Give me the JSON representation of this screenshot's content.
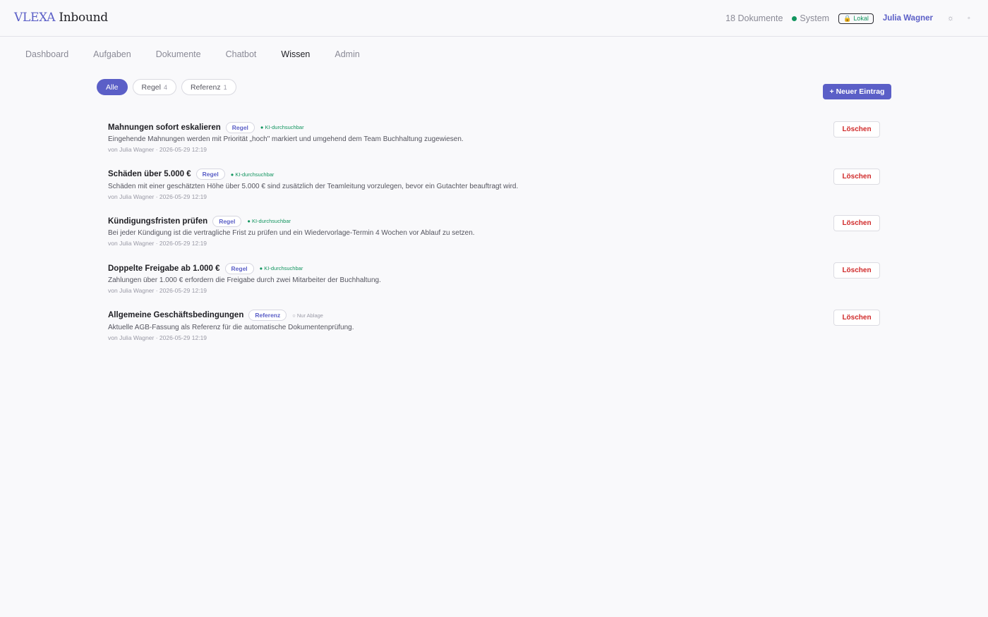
{
  "header": {
    "brand": "VLEXA",
    "product": "Inbound",
    "doc_count": "18 Dokumente",
    "system_status": "System",
    "local_badge": "Lokal",
    "user_name": "Julia Wagner",
    "icons": [
      "sun-icon",
      "settings-dot-icon"
    ],
    "status_color": "#12955f"
  },
  "nav": {
    "tabs": [
      "Dashboard",
      "Aufgaben",
      "Dokumente",
      "Chatbot",
      "Wissen",
      "Admin"
    ],
    "active": "Wissen"
  },
  "filters": {
    "all": "Alle",
    "rule": "Regel",
    "rule_count": "4",
    "reference": "Referenz",
    "reference_count": "1",
    "active": "Alle"
  },
  "new_entry_button": "+ Neuer Eintrag",
  "entries": [
    {
      "title": "Mahnungen sofort eskalieren",
      "tag": "Regel",
      "ki": "● KI-durchsuchbar",
      "desc": "Eingehende Mahnungen werden mit Priorität „hoch\" markiert und umgehend dem Team Buchhaltung zugewiesen.",
      "meta": "von Julia Wagner · 2026-05-29 12:19",
      "delete": "Löschen"
    },
    {
      "title": "Schäden über 5.000 €",
      "tag": "Regel",
      "ki": "● KI-durchsuchbar",
      "desc": "Schäden mit einer geschätzten Höhe über 5.000 € sind zusätzlich der Teamleitung vorzulegen, bevor ein Gutachter beauftragt wird.",
      "meta": "von Julia Wagner · 2026-05-29 12:19",
      "delete": "Löschen"
    },
    {
      "title": "Kündigungsfristen prüfen",
      "tag": "Regel",
      "ki": "● KI-durchsuchbar",
      "desc": "Bei jeder Kündigung ist die vertragliche Frist zu prüfen und ein Wiedervorlage-Termin 4 Wochen vor Ablauf zu setzen.",
      "meta": "von Julia Wagner · 2026-05-29 12:19",
      "delete": "Löschen"
    },
    {
      "title": "Doppelte Freigabe ab 1.000 €",
      "tag": "Regel",
      "ki": "● KI-durchsuchbar",
      "desc": "Zahlungen über 1.000 € erfordern die Freigabe durch zwei Mitarbeiter der Buchhaltung.",
      "meta": "von Julia Wagner · 2026-05-29 12:19",
      "delete": "Löschen"
    },
    {
      "title": "Allgemeine Geschäftsbedingungen",
      "tag": "Referenz",
      "ki": "○ Nur Ablage",
      "desc": "Aktuelle AGB-Fassung als Referenz für die automatische Dokumentenprüfung.",
      "meta": "von Julia Wagner · 2026-05-29 12:19",
      "delete": "Löschen"
    }
  ],
  "colors": {
    "accent": "#5b5fc7",
    "danger": "#d02a2a",
    "ki_on": "#12955f",
    "background": "#f9f9fb"
  }
}
